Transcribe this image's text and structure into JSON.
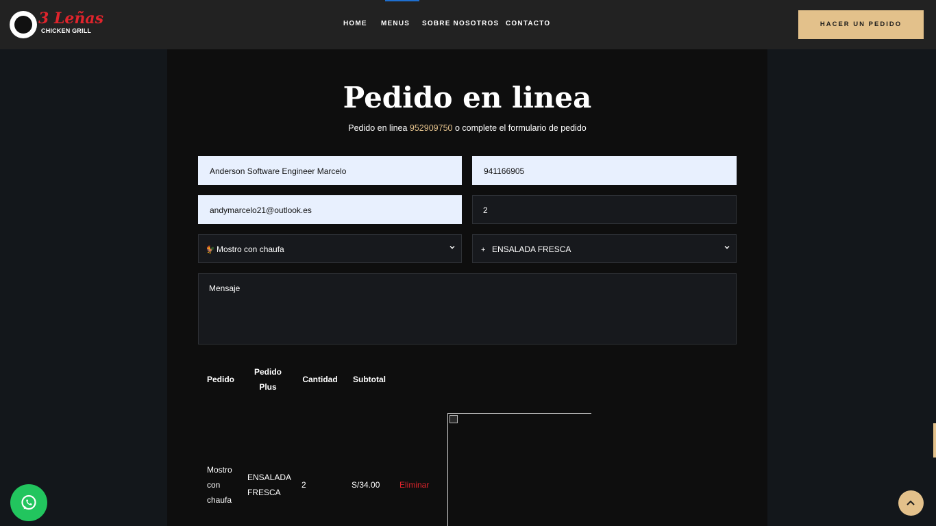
{
  "brand": {
    "title": "3 Leñas",
    "subtitle": "CHICKEN GRILL"
  },
  "nav": {
    "home": "HOME",
    "menus": "MENUS",
    "about": "SOBRE NOSOTROS",
    "contact": "CONTACTO"
  },
  "header": {
    "order_button": "HACER UN PEDIDO"
  },
  "page": {
    "title": "Pedido en linea",
    "subtitle_prefix": "Pedido en linea ",
    "phone": "952909750",
    "subtitle_suffix": " o complete el formulario de pedido"
  },
  "form": {
    "name": "Anderson Software Engineer Marcelo",
    "phone": "941166905",
    "email": "andymarcelo21@outlook.es",
    "quantity": "2",
    "dish": "Mostro con chaufa",
    "extra": "ENSALADA FRESCA",
    "message_placeholder": "Mensaje"
  },
  "table": {
    "headers": {
      "order": "Pedido",
      "plus_1": "Pedido",
      "plus_2": "Plus",
      "qty": "Cantidad",
      "subtotal": "Subtotal"
    },
    "row": {
      "order_1": "Mostro",
      "order_2": "con",
      "order_3": "chaufa",
      "plus_1": "ENSALADA",
      "plus_2": "FRESCA",
      "qty": "2",
      "subtotal": "S/34.00",
      "delete": "Eliminar"
    }
  },
  "colors": {
    "accent": "#e3c18b",
    "danger": "#e0242c",
    "whatsapp": "#22c55e",
    "nav_active": "#1e6fd0"
  }
}
